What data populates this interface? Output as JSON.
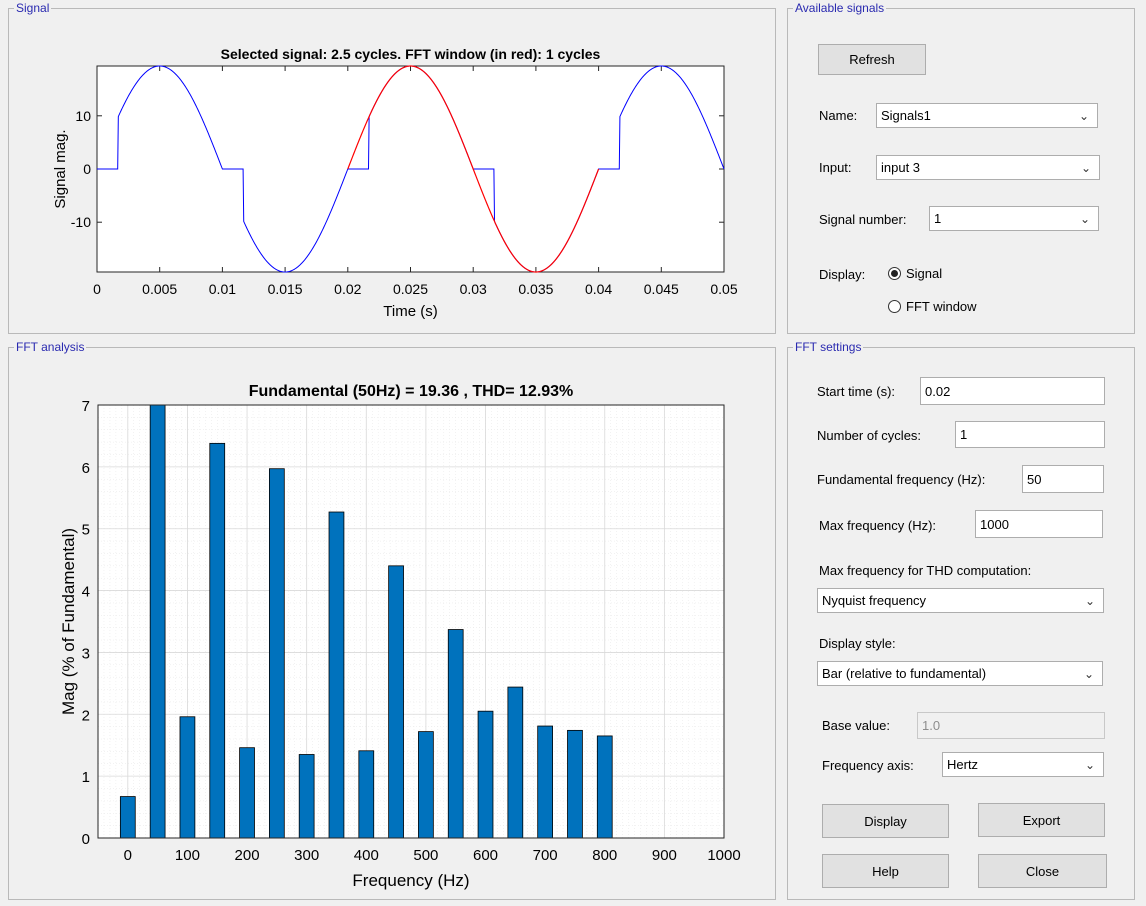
{
  "panels": {
    "signal": "Signal",
    "available": "Available signals",
    "fft": "FFT analysis",
    "settings": "FFT settings"
  },
  "signal_plot": {
    "title": "Selected signal: 2.5 cycles. FFT window (in red): 1 cycles",
    "xlabel": "Time (s)",
    "ylabel": "Signal mag.",
    "xticks": [
      "0",
      "0.005",
      "0.01",
      "0.015",
      "0.02",
      "0.025",
      "0.03",
      "0.035",
      "0.04",
      "0.045",
      "0.05"
    ],
    "yticks": [
      "10",
      "0",
      "-10"
    ]
  },
  "available": {
    "refresh": "Refresh",
    "name_label": "Name:",
    "name_value": "Signals1",
    "input_label": "Input:",
    "input_value": "input 3",
    "signum_label": "Signal number:",
    "signum_value": "1",
    "display_label": "Display:",
    "opt_signal": "Signal",
    "opt_fft": "FFT window"
  },
  "settings": {
    "start_label": "Start time (s):",
    "start_value": "0.02",
    "cycles_label": "Number of cycles:",
    "cycles_value": "1",
    "fund_label": "Fundamental frequency (Hz):",
    "fund_value": "50",
    "maxf_label": "Max frequency (Hz):",
    "maxf_value": "1000",
    "thd_label": "Max frequency for THD computation:",
    "thd_value": "Nyquist frequency",
    "style_label": "Display style:",
    "style_value": "Bar (relative to fundamental)",
    "base_label": "Base value:",
    "base_value": "1.0",
    "axis_label": "Frequency axis:",
    "axis_value": "Hertz",
    "display_btn": "Display",
    "export_btn": "Export",
    "help_btn": "Help",
    "close_btn": "Close"
  },
  "colors": {
    "bar": "#0072bd",
    "signal": "#0000ff",
    "window": "#ff0000",
    "title": "#2a2ab0"
  },
  "chart_data": {
    "type": "bar",
    "title": "Fundamental (50Hz) = 19.36 , THD= 12.93%",
    "xlabel": "Frequency (Hz)",
    "ylabel": "Mag (% of Fundamental)",
    "x": [
      0,
      50,
      100,
      150,
      200,
      250,
      300,
      350,
      400,
      450,
      500,
      550,
      600,
      650,
      700,
      750,
      800
    ],
    "values": [
      0.67,
      7.0,
      1.96,
      6.38,
      1.46,
      5.97,
      1.35,
      5.27,
      1.41,
      4.4,
      1.72,
      3.37,
      2.05,
      2.44,
      1.81,
      1.74,
      1.65
    ],
    "xlim": [
      -50,
      1000
    ],
    "ylim": [
      0,
      7
    ],
    "xticks": [
      "0",
      "100",
      "200",
      "300",
      "400",
      "500",
      "600",
      "700",
      "800",
      "900",
      "1000"
    ],
    "yticks": [
      "0",
      "1",
      "2",
      "3",
      "4",
      "5",
      "6",
      "7"
    ],
    "grid": true
  }
}
